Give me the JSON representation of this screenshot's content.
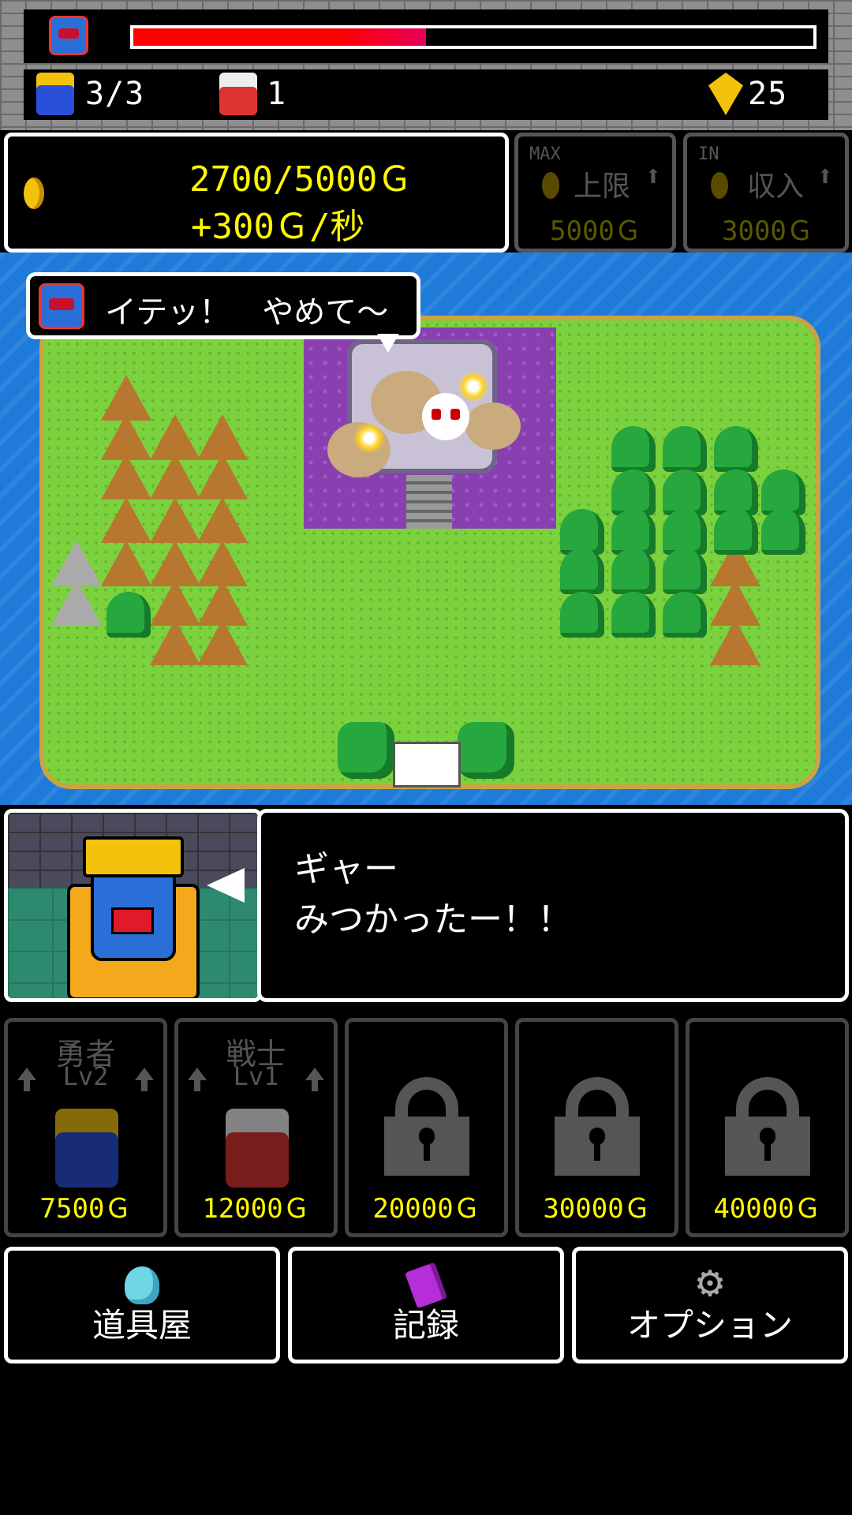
{
  "hud": {
    "hp_fraction": 0.43,
    "heroes": "3/3",
    "warriors": "1",
    "faith": "25"
  },
  "gold": {
    "amount": "2700/5000Ｇ",
    "rate": "+300Ｇ/秒"
  },
  "upgrades": {
    "cap": {
      "tag": "MAX",
      "label": "上限",
      "price": "5000Ｇ"
    },
    "income": {
      "tag": "IN",
      "label": "収入",
      "price": "3000Ｇ"
    }
  },
  "map": {
    "speech": "イテッ！　やめて〜"
  },
  "dialog": {
    "line1": "ギャー",
    "line2": "みつかったー！！"
  },
  "units": [
    {
      "name": "勇者",
      "level": "Lv2",
      "price": "7500Ｇ",
      "locked": false
    },
    {
      "name": "戦士",
      "level": "Lv1",
      "price": "12000Ｇ",
      "locked": false
    },
    {
      "price": "20000Ｇ",
      "locked": true
    },
    {
      "price": "30000Ｇ",
      "locked": true
    },
    {
      "price": "40000Ｇ",
      "locked": true
    }
  ],
  "menu": {
    "shop": "道具屋",
    "records": "記録",
    "options": "オプション"
  },
  "icons": [
    "demon-lord-icon",
    "hero-icon",
    "warrior-icon",
    "faith-icon",
    "coin-icon",
    "lock-icon",
    "potion-icon",
    "book-icon",
    "gear-icon"
  ],
  "colors": {
    "gold_text": "#fff700",
    "hp": "#ff0000",
    "sea": "#1e7bd9",
    "grass": "#7cd23e"
  }
}
